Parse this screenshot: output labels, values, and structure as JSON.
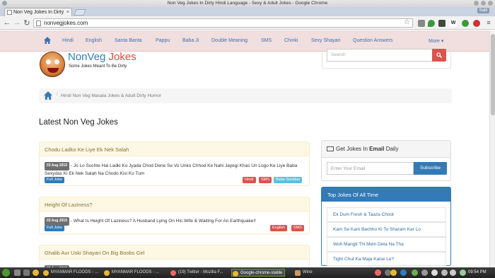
{
  "window": {
    "title": "Non Veg Jokes In Dirty Hindi Language - Sexy & Adult Jokes - Google Chrome",
    "user": "Salil"
  },
  "tab": {
    "label": "Non Veg Jokes In Dirty",
    "close": "×"
  },
  "address": {
    "url": "nonvegjokes.com"
  },
  "nav": {
    "items": [
      "Hindi",
      "English",
      "Santa Banta",
      "Pappu",
      "Baba Ji",
      "Double Meaning",
      "SMS",
      "Chinki",
      "Sexy Shayari",
      "Question Answers"
    ],
    "more": "More ▾"
  },
  "logo": {
    "title_a": "NonVeg",
    "title_b": " Jokes",
    "tagline": "Some Jokes Meant To Be Dirty"
  },
  "search": {
    "placeholder": "Search"
  },
  "breadcrumb": {
    "text": "Hindi Non Veg Masala Jokes & Adult Dirty Humor",
    "sep": "/"
  },
  "page": {
    "heading": "Latest Non Veg Jokes"
  },
  "jokes": [
    {
      "title": "Chodu Ladko Ke Liye Ek Nek Salah",
      "date": "03 Aug 2015",
      "text": " - Jo Lo Sochte Hai Ladki Ko Jyada Chod Dene Se Vo Unko Chhod Ke Nahi Jayegi Khas Un Logo Ke Liye Baba Sexydas Ki Ek Nek Salah Na Chodo Kisi Ko Tum",
      "link": "Full Joke",
      "tags": [
        "Hindi",
        "SMS",
        "Baba Saxidas"
      ]
    },
    {
      "title": "Height Of Laziness?",
      "date": "03 Aug 2015",
      "text": " - What Is Height Of Laziness? A Husband Lying On His Wife & Waiting For An Earthquake!!",
      "link": "Full Joke",
      "tags": [
        "English",
        "SMS"
      ]
    },
    {
      "title": "Ghalib Aur Uski Shayari On Big Boobs Girl",
      "date": "03 Aug 2015"
    }
  ],
  "subscribe": {
    "title_a": "Get Jokes In ",
    "title_b": "Email",
    "title_c": " Daily",
    "placeholder": "Enter Your Email",
    "button": "Subscribe"
  },
  "top_jokes": {
    "title": "Top Jokes Of All Time",
    "items": [
      "Ek Dum Fresh & Taaza Choot",
      "Kam Se Kam Bachho Ki To Sharam Kar Lo",
      "Woh Mangti Thi Mein Deta Na Tha",
      "Tight Chut Ka Maja Kaise Le?"
    ]
  },
  "taskbar": {
    "items": [
      "MYANMAR FLOODS - ...",
      "MYANMAR FLOODS - ...",
      "(19) Twitter - Mozilla F...",
      "Google-chrome-stable",
      "Wine"
    ],
    "clock": "09:54 PM"
  }
}
